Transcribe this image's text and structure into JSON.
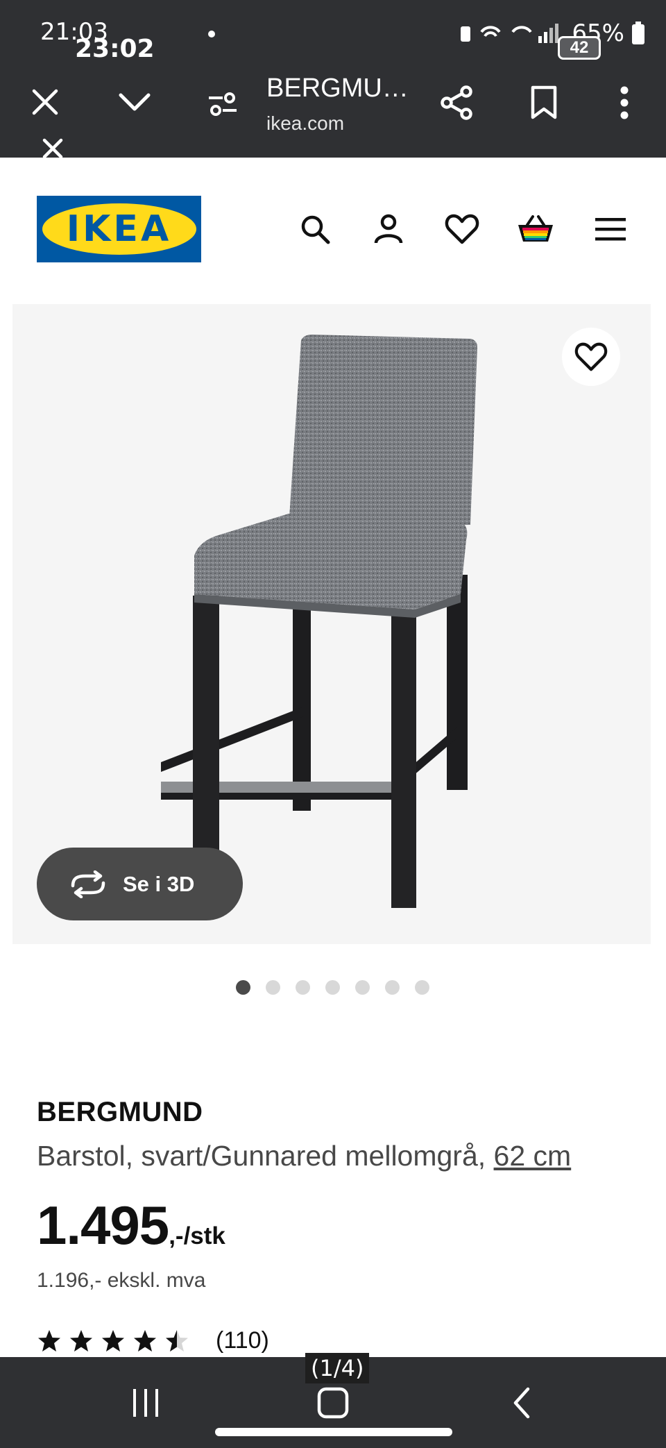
{
  "status_bar": {
    "time_primary": "21:03",
    "time_overlay": "23:02",
    "battery": "65%",
    "tab_count": "42"
  },
  "browser": {
    "page_title": "BERGMU…",
    "domain": "ikea.com",
    "icons": [
      "close-icon",
      "chevron-down-icon",
      "site-settings-icon",
      "share-icon",
      "bookmark-icon",
      "more-vert-icon"
    ]
  },
  "header": {
    "logo_text": "IKEA",
    "logo_mark": "®",
    "icons": [
      "search-icon",
      "account-icon",
      "heart-icon",
      "basket-icon",
      "menu-icon"
    ],
    "colors": {
      "logo_blue": "#0058a3",
      "logo_yellow": "#ffda1a"
    }
  },
  "gallery": {
    "button_3d_label": "Se i 3D",
    "image_count": 7,
    "active_index": 0
  },
  "product": {
    "name": "BERGMUND",
    "description": "Barstol, svart/Gunnared mellomgrå, ",
    "size_link": "62 cm",
    "price": "1.495",
    "price_suffix": ",-/stk",
    "price_ex_vat": "1.196,- ekskl. mva",
    "rating_stars": 4.5,
    "rating_max": 5,
    "review_count": "(110)"
  },
  "bottom_nav": {
    "page_indicator": "(1/4)",
    "icons": [
      "recent-apps-icon",
      "home-icon",
      "back-icon"
    ]
  }
}
